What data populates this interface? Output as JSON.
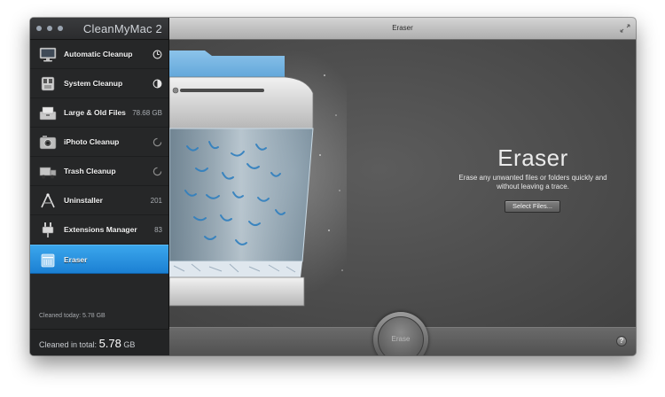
{
  "app": {
    "name": "CleanMyMac 2"
  },
  "sidebar": {
    "items": [
      {
        "label": "Automatic Cleanup",
        "value": "",
        "icon": "monitor-icon"
      },
      {
        "label": "System Cleanup",
        "value": "",
        "icon": "system-icon"
      },
      {
        "label": "Large & Old Files",
        "value": "78.68 GB",
        "icon": "file-box-icon"
      },
      {
        "label": "iPhoto Cleanup",
        "value": "",
        "icon": "camera-icon"
      },
      {
        "label": "Trash Cleanup",
        "value": "",
        "icon": "trash-truck-icon"
      },
      {
        "label": "Uninstaller",
        "value": "201",
        "icon": "uninstaller-icon"
      },
      {
        "label": "Extensions Manager",
        "value": "83",
        "icon": "plug-icon"
      },
      {
        "label": "Eraser",
        "value": "",
        "icon": "shredder-icon",
        "active": true
      }
    ],
    "cleaned_today": "Cleaned today: 5.78 GB",
    "cleaned_total_label": "Cleaned in total:",
    "cleaned_total_value": "5.78",
    "cleaned_total_unit": "GB"
  },
  "main": {
    "window_title": "Eraser",
    "heading": "Eraser",
    "description": "Erase any unwanted files or folders quickly and without leaving a trace.",
    "select_button": "Select Files...",
    "erase_button": "Erase",
    "help_button": "?"
  },
  "colors": {
    "accent": "#2a93e0",
    "sidebar_bg": "#262728",
    "content_bg": "#4d4d4d"
  }
}
